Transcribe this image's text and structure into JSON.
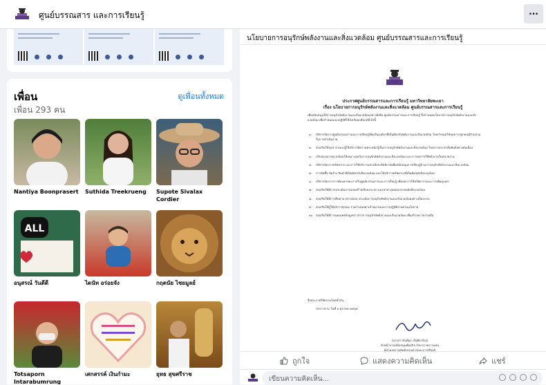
{
  "header": {
    "page_title": "ศูนย์บรรณสาร และการเรียนรู้",
    "more_label": "···"
  },
  "friends": {
    "title": "เพื่อน",
    "count": "เพื่อน 293 คน",
    "see_all": "ดูเพื่อนทั้งหมด",
    "list": [
      {
        "name": "Nantiya Boonprasert"
      },
      {
        "name": "Suthida Treekrueng"
      },
      {
        "name": "Supote Sivalax Cordier"
      },
      {
        "name": "อนุสรณ์ วันดีดี"
      },
      {
        "name": "ไดนัท อร่อยจัง"
      },
      {
        "name": "กฤตนัย ไชยมูลย์"
      },
      {
        "name": "Totsaporn Intarabumrung"
      },
      {
        "name": "เศกสรรค์ เงินกำมะ"
      },
      {
        "name": "ยุทธ สุขศรีราช"
      }
    ]
  },
  "post": {
    "heading": "นโยบายการอนุรักษ์พลังงานและสิ่งแวดล้อม ศูนย์บรรณสารและการเรียนรู้",
    "doc_head1": "ประกาศศูนย์บรรณสารและการเรียนรู้ มหาวิทยาลัยพะเยา",
    "doc_head2": "เรื่อง นโยบายการอนุรักษ์พลังงานและสิ่งแวดล้อม ศูนย์บรรณสารและการเรียนรู้",
    "doc_intro": "เพื่อสนับสนุนให้การอนุรักษ์พลังงานและสิ่งแวดล้อมอย่างยั่งยืน ศูนย์บรรณสารและการเรียนรู้ จึงกำหนดนโยบายการอนุรักษ์พลังงานและสิ่งแวดล้อม เพื่อกำหนดแนวปฏิบัติให้บังเกิดผลสัมฤทธิ์ ดังนี้",
    "doc_items": [
      {
        "num": "๑.",
        "text": "บริหารจัดการศูนย์บรรณสารและการเรียนรู้เพื่อเป็นองค์กรที่เป็นมิตรกับพลังงานและสิ่งแวดล้อม โดยกำหนดให้บุคลากรทุกคนมีส่วนร่วมในการดำเนินงาน"
      },
      {
        "num": "๒.",
        "text": "ส่งเสริมให้บุคลากรและผู้ใช้บริการมีความตระหนักรู้เรื่องการอนุรักษ์พลังงานและสิ่งแวดล้อม โดยการประชาสัมพันธ์อย่างต่อเนื่อง"
      },
      {
        "num": "๓.",
        "text": "ปรับปรุงสภาพแวดล้อมให้เหมาะสมกับการอนุรักษ์พลังงานและสิ่งแวดล้อม และการลดการใช้พลังงานในหน่วยงาน"
      },
      {
        "num": "๔.",
        "text": "บริหารจัดการทรัพยากร และการใช้บริการอย่างมีประสิทธิภาพเพื่อสนับสนุนการเรียนรู้ด้านการอนุรักษ์พลังงานและสิ่งแวดล้อม"
      },
      {
        "num": "๕.",
        "text": "การจัดซื้อ จัดจ้าง สินค้าที่เป็นมิตรกับสิ่งแวดล้อม และให้บริการทรัพยากรที่เป็นมิตรต่อสิ่งแวดล้อม"
      },
      {
        "num": "๖.",
        "text": "บริหารจัดการการคัดแยกขยะภายในศูนย์บรรณสารและการเรียนรู้ เพื่อลดการใช้ทรัพยากรและการเพิ่มคุณค่า"
      },
      {
        "num": "๗.",
        "text": "ส่งเสริมให้มีการประเมินการปล่อยก๊าซเรือนกระจก และหาทางลดผลกระทบต่อสิ่งแวดล้อม"
      },
      {
        "num": "๘.",
        "text": "ส่งเสริมให้มีการติดตาม ตรวจสอบ ประเมินการอนุรักษ์พลังงานและสิ่งแวดล้อมอย่างเป็นระบบ"
      },
      {
        "num": "๙.",
        "text": "ส่งเสริมให้ผู้ใช้บริการทุกคน ร่วมกำหนดค่าเป้าหมายและการปฏิบัติงานตามนโยบาย"
      },
      {
        "num": "๑๐.",
        "text": "ส่งเสริมให้มีการเผยแพร่ข้อมูลข่าวสารการอนุรักษ์พลังงานและสิ่งแวดล้อม เพื่อสร้างความร่วมมือ"
      }
    ],
    "doc_close": "จึงประกาศให้ทราบโดยทั่วกัน",
    "doc_date": "ประกาศ ณ วันที่ ๑ ตุลาคม ๒๕๖๔",
    "doc_signer1": "(นางสาวกันติญา สันติธรรังสุ)",
    "doc_signer2": "หัวหน้างานสนับสนุนพันธกิจ รักษาราชการแทน",
    "doc_signer3": "ผู้อำนวยการศูนย์บรรณสารและการเรียนรู้",
    "like_label": "ถูกใจ",
    "comment_label": "แสดงความคิดเห็น",
    "share_label": "แชร์",
    "comment_placeholder": "เขียนความคิดเห็น..."
  },
  "colors": {
    "accent": "#1877f2",
    "background": "#f0f2f5",
    "muted": "#65676b"
  }
}
